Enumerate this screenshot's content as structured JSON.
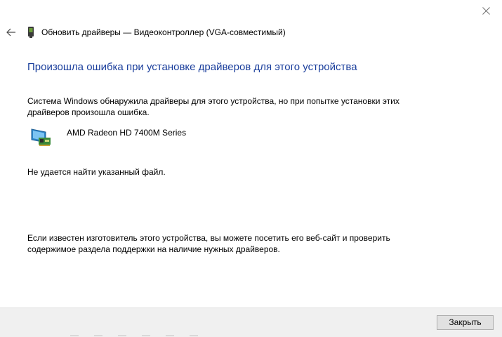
{
  "window": {
    "title": "Обновить драйверы — Видеоконтроллер (VGA-совместимый)",
    "close_symbol": "×"
  },
  "icons": {
    "close": "close-icon",
    "back": "back-arrow-icon",
    "header": "device-manager-icon",
    "device": "display-adapter-icon"
  },
  "content": {
    "heading": "Произошла ошибка при установке драйверов для этого устройства",
    "description": "Система Windows обнаружила драйверы для этого устройства, но при попытке установки этих драйверов произошла ошибка.",
    "device_name": "AMD Radeon HD 7400M Series",
    "error": "Не удается найти указанный файл.",
    "footer": "Если известен изготовитель этого устройства, вы можете посетить его веб-сайт и проверить содержимое раздела поддержки на наличие нужных драйверов."
  },
  "buttons": {
    "close_label": "Закрыть"
  },
  "colors": {
    "heading": "#1a3e9c",
    "button_bar": "#f0f0f0",
    "button_face": "#e1e1e1",
    "button_border": "#adadad"
  }
}
